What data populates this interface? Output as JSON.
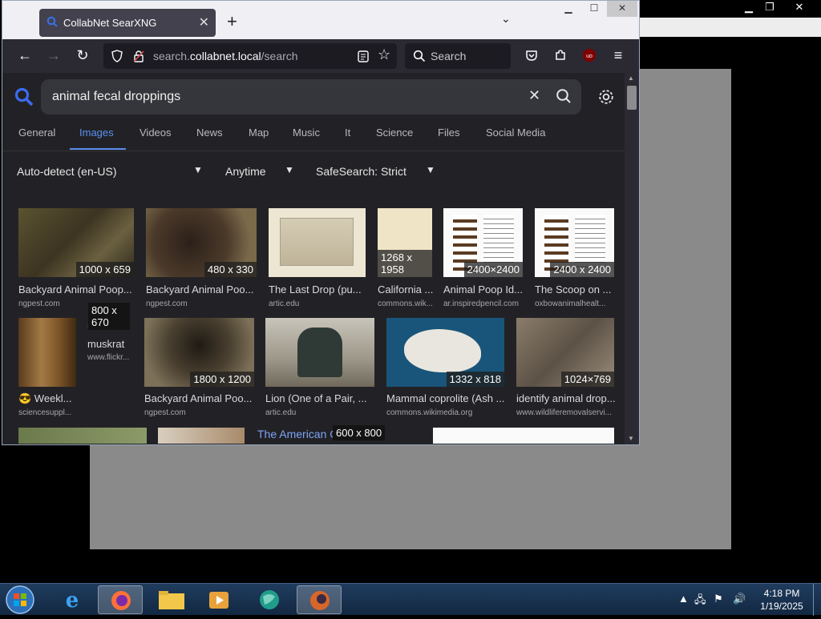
{
  "browser": {
    "tab_title": "CollabNet SearXNG",
    "tab_close": "✕",
    "new_tab": "+",
    "tab_list": "⌄",
    "url_prefix": "search.",
    "url_domain": "collabnet.local",
    "url_path": "/search",
    "search_placeholder": "Search"
  },
  "searxng": {
    "query": "animal fecal droppings",
    "categories": [
      "General",
      "Images",
      "Videos",
      "News",
      "Map",
      "Music",
      "It",
      "Science",
      "Files",
      "Social Media"
    ],
    "active_category": "Images",
    "filters": {
      "language": "Auto-detect (en-US)",
      "time": "Anytime",
      "safesearch": "SafeSearch: Strict"
    },
    "results": [
      {
        "title": "Backyard Animal Poop...",
        "source": "ngpest.com",
        "dims": "1000 x 659"
      },
      {
        "title": "Backyard Animal Poo...",
        "source": "ngpest.com",
        "dims": "480 x 330"
      },
      {
        "title": "The Last Drop (pu...",
        "source": "artic.edu",
        "dims": ""
      },
      {
        "title": "California ...",
        "source": "commons.wik...",
        "dims": "1268 x 1958"
      },
      {
        "title": "Animal Poop Id...",
        "source": "ar.inspiredpencil.com",
        "dims": "2400×2400"
      },
      {
        "title": "The Scoop on ...",
        "source": "oxbowanimalhealt...",
        "dims": "2400 x 2400"
      },
      {
        "title": "😎 Weekl...",
        "source": "sciencesuppl...",
        "dims": ""
      },
      {
        "title": "muskrat",
        "source": "www.flickr...",
        "dims": "800 x 670",
        "alt": "muskrat"
      },
      {
        "title": "Backyard Animal Poo...",
        "source": "ngpest.com",
        "dims": "1800 x 1200"
      },
      {
        "title": "Lion (One of a Pair, ...",
        "source": "artic.edu",
        "dims": ""
      },
      {
        "title": "Mammal coprolite (Ash ...",
        "source": "commons.wikimedia.org",
        "dims": "1332 x 818"
      },
      {
        "title": "identify animal drop...",
        "source": "www.wildliferemovalservi...",
        "dims": "1024×769"
      }
    ],
    "partial": {
      "alt_text": "The American Ge",
      "dims": "600 x 800"
    }
  },
  "taskbar": {
    "time": "4:18 PM",
    "date": "1/19/2025"
  },
  "colors": {
    "accent": "#5b8ef0",
    "page_bg": "#222226",
    "toolbar": "#2b2a33"
  }
}
